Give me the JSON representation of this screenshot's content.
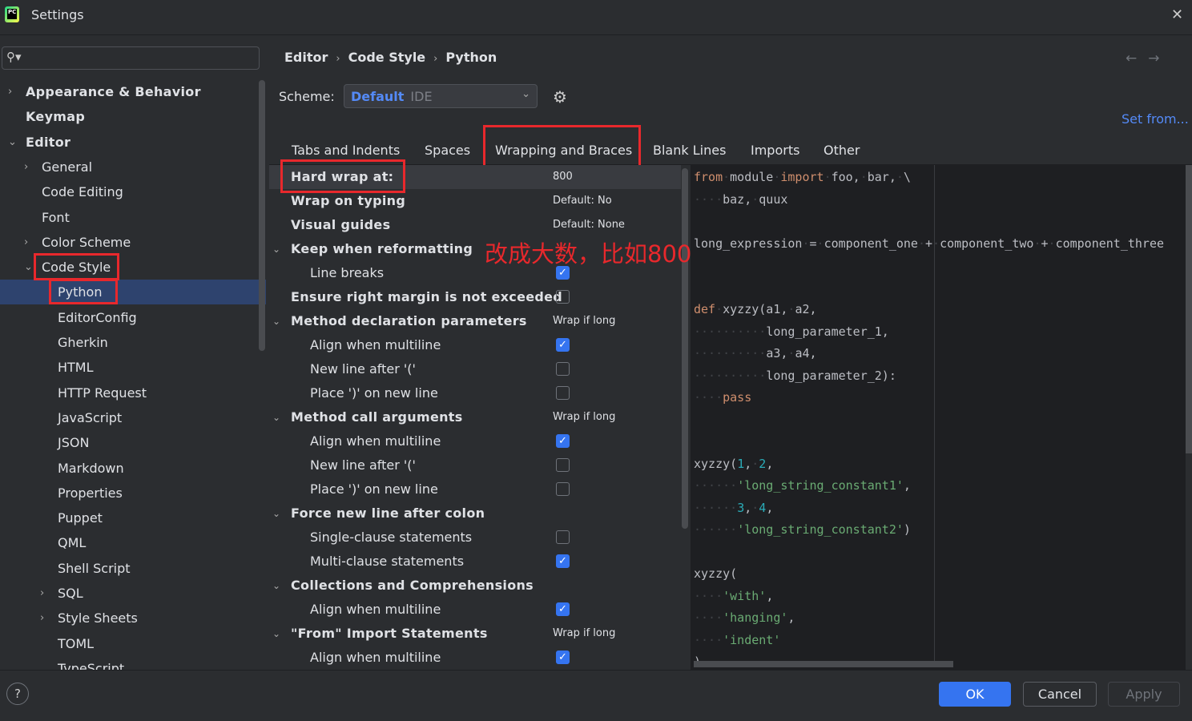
{
  "window": {
    "title": "Settings"
  },
  "search": {
    "placeholder": ""
  },
  "sidebar": {
    "items": [
      {
        "label": "Appearance & Behavior",
        "level": 0,
        "chev": "›",
        "bold": true
      },
      {
        "label": "Keymap",
        "level": 0,
        "chev": "",
        "bold": true
      },
      {
        "label": "Editor",
        "level": 0,
        "chev": "⌄",
        "bold": true
      },
      {
        "label": "General",
        "level": 1,
        "chev": "›"
      },
      {
        "label": "Code Editing",
        "level": 1,
        "chev": ""
      },
      {
        "label": "Font",
        "level": 1,
        "chev": ""
      },
      {
        "label": "Color Scheme",
        "level": 1,
        "chev": "›"
      },
      {
        "label": "Code Style",
        "level": 1,
        "chev": "⌄"
      },
      {
        "label": "Python",
        "level": 2,
        "chev": "",
        "selected": true
      },
      {
        "label": "EditorConfig",
        "level": 2,
        "chev": ""
      },
      {
        "label": "Gherkin",
        "level": 2,
        "chev": ""
      },
      {
        "label": "HTML",
        "level": 2,
        "chev": ""
      },
      {
        "label": "HTTP Request",
        "level": 2,
        "chev": ""
      },
      {
        "label": "JavaScript",
        "level": 2,
        "chev": ""
      },
      {
        "label": "JSON",
        "level": 2,
        "chev": ""
      },
      {
        "label": "Markdown",
        "level": 2,
        "chev": ""
      },
      {
        "label": "Properties",
        "level": 2,
        "chev": ""
      },
      {
        "label": "Puppet",
        "level": 2,
        "chev": ""
      },
      {
        "label": "QML",
        "level": 2,
        "chev": ""
      },
      {
        "label": "Shell Script",
        "level": 2,
        "chev": ""
      },
      {
        "label": "SQL",
        "level": 2,
        "chev": "›"
      },
      {
        "label": "Style Sheets",
        "level": 2,
        "chev": "›"
      },
      {
        "label": "TOML",
        "level": 2,
        "chev": ""
      },
      {
        "label": "TypeScript",
        "level": 2,
        "chev": ""
      }
    ]
  },
  "breadcrumb": [
    "Editor",
    "Code Style",
    "Python"
  ],
  "scheme": {
    "label": "Scheme:",
    "value": "Default",
    "meta": "IDE"
  },
  "set_from": "Set from...",
  "tabs": [
    "Tabs and Indents",
    "Spaces",
    "Wrapping and Braces",
    "Blank Lines",
    "Imports",
    "Other"
  ],
  "active_tab": "Wrapping and Braces",
  "options": [
    {
      "label": "Hard wrap at:",
      "value": "800",
      "group": true,
      "highlight": true
    },
    {
      "label": "Wrap on typing",
      "value": "Default: No",
      "group": true
    },
    {
      "label": "Visual guides",
      "value": "Default: None",
      "group": true
    },
    {
      "label": "Keep when reformatting",
      "group": true,
      "expand": true
    },
    {
      "label": "Line breaks",
      "checked": true
    },
    {
      "label": "Ensure right margin is not exceeded",
      "group": true,
      "checked": false
    },
    {
      "label": "Method declaration parameters",
      "value": "Wrap if long",
      "group": true,
      "expand": true
    },
    {
      "label": "Align when multiline",
      "checked": true
    },
    {
      "label": "New line after '('",
      "checked": false
    },
    {
      "label": "Place ')' on new line",
      "checked": false
    },
    {
      "label": "Method call arguments",
      "value": "Wrap if long",
      "group": true,
      "expand": true
    },
    {
      "label": "Align when multiline",
      "checked": true
    },
    {
      "label": "New line after '('",
      "checked": false
    },
    {
      "label": "Place ')' on new line",
      "checked": false
    },
    {
      "label": "Force new line after colon",
      "group": true,
      "expand": true
    },
    {
      "label": "Single-clause statements",
      "checked": false
    },
    {
      "label": "Multi-clause statements",
      "checked": true
    },
    {
      "label": "Collections and Comprehensions",
      "group": true,
      "expand": true
    },
    {
      "label": "Align when multiline",
      "checked": true
    },
    {
      "label": "\"From\" Import Statements",
      "value": "Wrap if long",
      "group": true,
      "expand": true
    },
    {
      "label": "Align when multiline",
      "checked": true
    }
  ],
  "annotation": "改成大数，比如800",
  "code_lines": [
    [
      [
        "from",
        "kw"
      ],
      [
        "·",
        "dot"
      ],
      [
        "module",
        "t"
      ],
      [
        "·",
        "dot"
      ],
      [
        "import",
        "kw"
      ],
      [
        "·",
        "dot"
      ],
      [
        "foo,",
        "t"
      ],
      [
        "·",
        "dot"
      ],
      [
        "bar,",
        "t"
      ],
      [
        "·",
        "dot"
      ],
      [
        "\\",
        "t"
      ]
    ],
    [
      [
        "····",
        "dot"
      ],
      [
        "baz,",
        "t"
      ],
      [
        "·",
        "dot"
      ],
      [
        "quux",
        "t"
      ]
    ],
    [],
    [
      [
        "long_expression",
        "t"
      ],
      [
        "·",
        "dot"
      ],
      [
        "=",
        "t"
      ],
      [
        "·",
        "dot"
      ],
      [
        "component_one",
        "t"
      ],
      [
        "·",
        "dot"
      ],
      [
        "+",
        "t"
      ],
      [
        "·",
        "dot"
      ],
      [
        "component_two",
        "t"
      ],
      [
        "·",
        "dot"
      ],
      [
        "+",
        "t"
      ],
      [
        "·",
        "dot"
      ],
      [
        "component_three",
        "t"
      ]
    ],
    [],
    [],
    [
      [
        "def",
        "kw"
      ],
      [
        "·",
        "dot"
      ],
      [
        "xyzzy(a1,",
        "t"
      ],
      [
        "·",
        "dot"
      ],
      [
        "a2,",
        "t"
      ]
    ],
    [
      [
        "··········",
        "dot"
      ],
      [
        "long_parameter_1,",
        "t"
      ]
    ],
    [
      [
        "··········",
        "dot"
      ],
      [
        "a3,",
        "t"
      ],
      [
        "·",
        "dot"
      ],
      [
        "a4,",
        "t"
      ]
    ],
    [
      [
        "··········",
        "dot"
      ],
      [
        "long_parameter_2):",
        "t"
      ]
    ],
    [
      [
        "····",
        "dot"
      ],
      [
        "pass",
        "kw"
      ]
    ],
    [],
    [],
    [
      [
        "xyzzy(",
        "t"
      ],
      [
        "1",
        "num"
      ],
      [
        ",",
        "t"
      ],
      [
        "·",
        "dot"
      ],
      [
        "2",
        "num"
      ],
      [
        ",",
        "t"
      ]
    ],
    [
      [
        "······",
        "dot"
      ],
      [
        "'long_string_constant1'",
        "str"
      ],
      [
        ",",
        "t"
      ]
    ],
    [
      [
        "······",
        "dot"
      ],
      [
        "3",
        "num"
      ],
      [
        ",",
        "t"
      ],
      [
        "·",
        "dot"
      ],
      [
        "4",
        "num"
      ],
      [
        ",",
        "t"
      ]
    ],
    [
      [
        "······",
        "dot"
      ],
      [
        "'long_string_constant2'",
        "str"
      ],
      [
        ")",
        "t"
      ]
    ],
    [],
    [
      [
        "xyzzy(",
        "t"
      ]
    ],
    [
      [
        "····",
        "dot"
      ],
      [
        "'with'",
        "str"
      ],
      [
        ",",
        "t"
      ]
    ],
    [
      [
        "····",
        "dot"
      ],
      [
        "'hanging'",
        "str"
      ],
      [
        ",",
        "t"
      ]
    ],
    [
      [
        "····",
        "dot"
      ],
      [
        "'indent'",
        "str"
      ]
    ],
    [
      [
        ")",
        "t"
      ]
    ]
  ],
  "buttons": {
    "ok": "OK",
    "cancel": "Cancel",
    "apply": "Apply",
    "help": "?"
  },
  "colors": {
    "accent": "#3574f0",
    "highlight_box": "#e8282c",
    "selection": "#2e436e"
  }
}
